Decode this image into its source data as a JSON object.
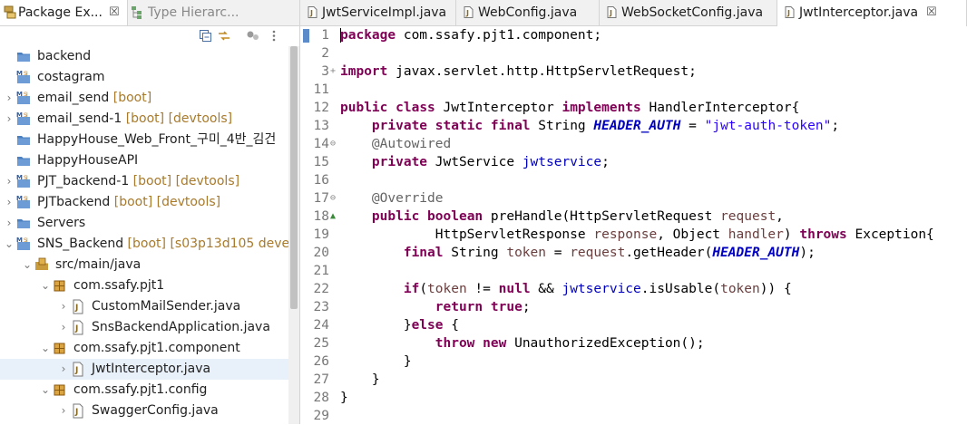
{
  "left_panel": {
    "tabs": [
      {
        "label": "Package Ex...",
        "close": "☒",
        "icon": "package-explorer-icon"
      },
      {
        "label": "Type Hierarc...",
        "icon": "type-hierarchy-icon"
      }
    ],
    "toolbar": [
      "collapse-all-icon",
      "link-with-editor-icon",
      "filter-icon",
      "view-menu-icon"
    ],
    "tree": [
      {
        "label": "backend",
        "dec": "",
        "icon": "folder-icon",
        "indent": 0,
        "chevron": "",
        "selected": false
      },
      {
        "label": "costagram",
        "dec": "",
        "icon": "maven-project-icon",
        "indent": 0,
        "chevron": "",
        "selected": false
      },
      {
        "label": "email_send",
        "dec": "[boot]",
        "icon": "maven-project-icon",
        "indent": 0,
        "chevron": "›",
        "selected": false
      },
      {
        "label": "email_send-1",
        "dec": "[boot] [devtools]",
        "icon": "maven-project-icon",
        "indent": 0,
        "chevron": "›",
        "selected": false
      },
      {
        "label": "HappyHouse_Web_Front_구미_4반_김건",
        "dec": "",
        "icon": "folder-icon",
        "indent": 0,
        "chevron": "",
        "selected": false
      },
      {
        "label": "HappyHouseAPI",
        "dec": "",
        "icon": "folder-icon",
        "indent": 0,
        "chevron": "",
        "selected": false
      },
      {
        "label": "PJT_backend-1",
        "dec": "[boot] [devtools]",
        "icon": "maven-project-icon",
        "indent": 0,
        "chevron": "›",
        "selected": false
      },
      {
        "label": "PJTbackend",
        "dec": "[boot] [devtools]",
        "icon": "maven-project-icon",
        "indent": 0,
        "chevron": "›",
        "selected": false
      },
      {
        "label": "Servers",
        "dec": "",
        "icon": "folder-icon",
        "indent": 0,
        "chevron": "›",
        "selected": false
      },
      {
        "label": "SNS_Backend",
        "dec": "[boot] [s03p13d105 deve",
        "icon": "maven-project-icon",
        "indent": 0,
        "chevron": "⌄",
        "selected": false
      },
      {
        "label": "src/main/java",
        "dec": "",
        "icon": "source-folder-icon",
        "indent": 1,
        "chevron": "⌄",
        "selected": false
      },
      {
        "label": "com.ssafy.pjt1",
        "dec": "",
        "icon": "package-icon",
        "indent": 2,
        "chevron": "⌄",
        "selected": false
      },
      {
        "label": "CustomMailSender.java",
        "dec": "",
        "icon": "java-file-icon",
        "indent": 3,
        "chevron": "›",
        "selected": false
      },
      {
        "label": "SnsBackendApplication.java",
        "dec": "",
        "icon": "java-file-icon",
        "indent": 3,
        "chevron": "›",
        "selected": false
      },
      {
        "label": "com.ssafy.pjt1.component",
        "dec": "",
        "icon": "package-icon",
        "indent": 2,
        "chevron": "⌄",
        "selected": false
      },
      {
        "label": "JwtInterceptor.java",
        "dec": "",
        "icon": "java-file-icon",
        "indent": 3,
        "chevron": "›",
        "selected": true
      },
      {
        "label": "com.ssafy.pjt1.config",
        "dec": "",
        "icon": "package-icon",
        "indent": 2,
        "chevron": "⌄",
        "selected": false
      },
      {
        "label": "SwaggerConfig.java",
        "dec": "",
        "icon": "java-file-icon",
        "indent": 3,
        "chevron": "›",
        "selected": false
      }
    ]
  },
  "editor": {
    "tabs": [
      {
        "label": "JwtServiceImpl.java",
        "active": false,
        "close": ""
      },
      {
        "label": "WebConfig.java",
        "active": false,
        "close": ""
      },
      {
        "label": "WebSocketConfig.java",
        "active": false,
        "close": ""
      },
      {
        "label": "JwtInterceptor.java",
        "active": true,
        "close": "☒"
      }
    ],
    "lines": [
      {
        "n": "1",
        "fold": "",
        "tokens": [
          [
            "k",
            "package"
          ],
          [
            "t",
            " com.ssafy.pjt1.component;"
          ]
        ]
      },
      {
        "n": "2",
        "fold": "",
        "tokens": []
      },
      {
        "n": "3",
        "fold": "+",
        "tokens": [
          [
            "k",
            "import"
          ],
          [
            "t",
            " javax.servlet.http.HttpServletRequest;"
          ]
        ]
      },
      {
        "n": "11",
        "fold": "",
        "tokens": []
      },
      {
        "n": "12",
        "fold": "",
        "tokens": [
          [
            "k",
            "public"
          ],
          [
            "t",
            " "
          ],
          [
            "k",
            "class"
          ],
          [
            "t",
            " JwtInterceptor "
          ],
          [
            "k",
            "implements"
          ],
          [
            "t",
            " HandlerInterceptor{"
          ]
        ]
      },
      {
        "n": "13",
        "fold": "",
        "tokens": [
          [
            "t",
            "    "
          ],
          [
            "k",
            "private"
          ],
          [
            "t",
            " "
          ],
          [
            "k",
            "static"
          ],
          [
            "t",
            " "
          ],
          [
            "k",
            "final"
          ],
          [
            "t",
            " String "
          ],
          [
            "f",
            "HEADER_AUTH"
          ],
          [
            "t",
            " = "
          ],
          [
            "s",
            "\"jwt-auth-token\""
          ],
          [
            "t",
            ";"
          ]
        ]
      },
      {
        "n": "14",
        "fold": "⊖",
        "tokens": [
          [
            "t",
            "    "
          ],
          [
            "a",
            "@Autowired"
          ]
        ]
      },
      {
        "n": "15",
        "fold": "",
        "tokens": [
          [
            "t",
            "    "
          ],
          [
            "k",
            "private"
          ],
          [
            "t",
            " JwtService "
          ],
          [
            "fv",
            "jwtservice"
          ],
          [
            "t",
            ";"
          ]
        ]
      },
      {
        "n": "16",
        "fold": "",
        "tokens": []
      },
      {
        "n": "17",
        "fold": "⊖",
        "tokens": [
          [
            "t",
            "    "
          ],
          [
            "a",
            "@Override"
          ]
        ]
      },
      {
        "n": "18",
        "fold": "▲",
        "tokens": [
          [
            "t",
            "    "
          ],
          [
            "k",
            "public"
          ],
          [
            "t",
            " "
          ],
          [
            "k",
            "boolean"
          ],
          [
            "t",
            " preHandle(HttpServletRequest "
          ],
          [
            "p",
            "request"
          ],
          [
            "t",
            ","
          ]
        ]
      },
      {
        "n": "19",
        "fold": "",
        "tokens": [
          [
            "t",
            "            HttpServletResponse "
          ],
          [
            "p",
            "response"
          ],
          [
            "t",
            ", Object "
          ],
          [
            "p",
            "handler"
          ],
          [
            "t",
            ") "
          ],
          [
            "k",
            "throws"
          ],
          [
            "t",
            " Exception{"
          ]
        ]
      },
      {
        "n": "20",
        "fold": "",
        "tokens": [
          [
            "t",
            "        "
          ],
          [
            "k",
            "final"
          ],
          [
            "t",
            " String "
          ],
          [
            "p",
            "token"
          ],
          [
            "t",
            " = "
          ],
          [
            "p",
            "request"
          ],
          [
            "t",
            ".getHeader("
          ],
          [
            "f",
            "HEADER_AUTH"
          ],
          [
            "t",
            ");"
          ]
        ]
      },
      {
        "n": "21",
        "fold": "",
        "tokens": []
      },
      {
        "n": "22",
        "fold": "",
        "tokens": [
          [
            "t",
            "        "
          ],
          [
            "k",
            "if"
          ],
          [
            "t",
            "("
          ],
          [
            "p",
            "token"
          ],
          [
            "t",
            " != "
          ],
          [
            "k",
            "null"
          ],
          [
            "t",
            " && "
          ],
          [
            "fv",
            "jwtservice"
          ],
          [
            "t",
            ".isUsable("
          ],
          [
            "p",
            "token"
          ],
          [
            "t",
            ")) {"
          ]
        ]
      },
      {
        "n": "23",
        "fold": "",
        "tokens": [
          [
            "t",
            "            "
          ],
          [
            "k",
            "return"
          ],
          [
            "t",
            " "
          ],
          [
            "k",
            "true"
          ],
          [
            "t",
            ";"
          ]
        ]
      },
      {
        "n": "24",
        "fold": "",
        "tokens": [
          [
            "t",
            "        }"
          ],
          [
            "k",
            "else"
          ],
          [
            "t",
            " {"
          ]
        ]
      },
      {
        "n": "25",
        "fold": "",
        "tokens": [
          [
            "t",
            "            "
          ],
          [
            "k",
            "throw"
          ],
          [
            "t",
            " "
          ],
          [
            "k",
            "new"
          ],
          [
            "t",
            " UnauthorizedException();"
          ]
        ]
      },
      {
        "n": "26",
        "fold": "",
        "tokens": [
          [
            "t",
            "        }"
          ]
        ]
      },
      {
        "n": "27",
        "fold": "",
        "tokens": [
          [
            "t",
            "    }"
          ]
        ]
      },
      {
        "n": "28",
        "fold": "",
        "tokens": [
          [
            "t",
            "}"
          ]
        ]
      },
      {
        "n": "29",
        "fold": "",
        "tokens": []
      }
    ]
  }
}
